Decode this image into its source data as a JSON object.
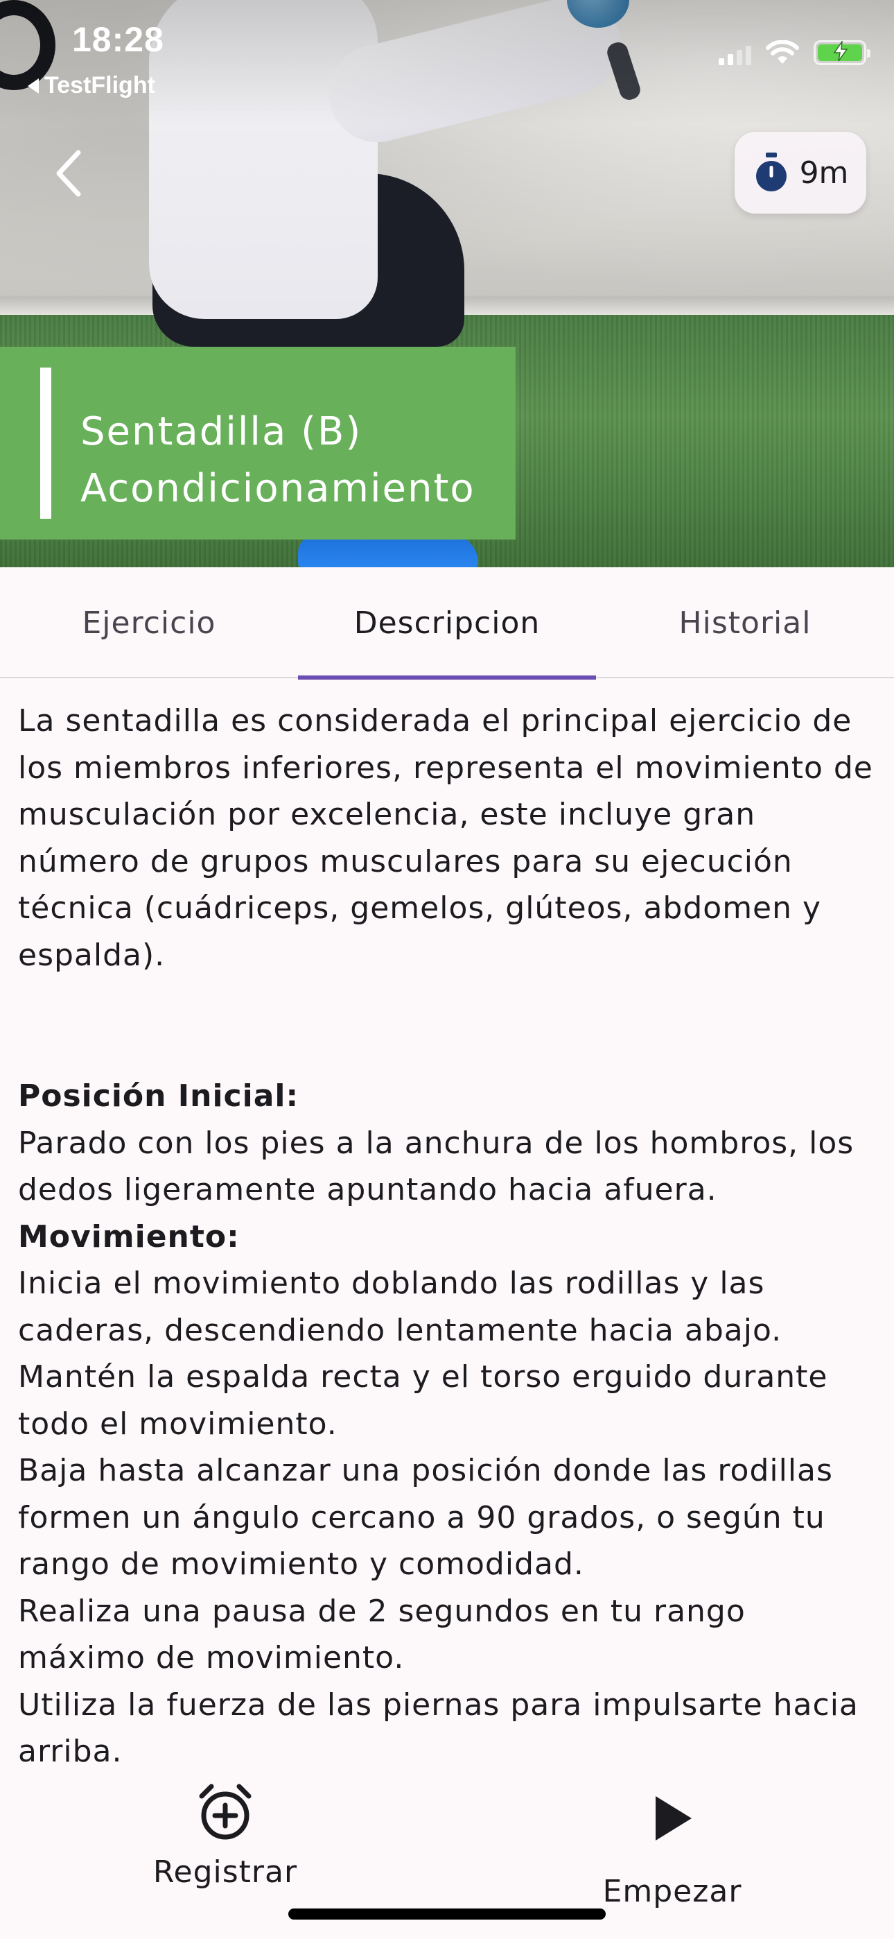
{
  "status_bar": {
    "time": "18:28",
    "back_app": "TestFlight",
    "battery_color": "#5fd34b"
  },
  "header": {
    "back_icon": "chevron-left-icon",
    "timer": {
      "icon": "stopwatch-icon",
      "label": "9m",
      "icon_color": "#1f3b73"
    }
  },
  "exercise": {
    "title": "Sentadilla (B)",
    "category": "Acondicionamiento",
    "banner_color": "#69b05b"
  },
  "tabs": [
    {
      "label": "Ejercicio",
      "active": false
    },
    {
      "label": "Descripcion",
      "active": true
    },
    {
      "label": "Historial",
      "active": false
    }
  ],
  "accent_color": "#6a4fb0",
  "description": {
    "intro": "La sentadilla es considerada el principal ejercicio de los miembros inferiores, representa el movimiento de musculación por excelencia, este incluye gran número de grupos musculares para su ejecución técnica (cuádriceps, gemelos, glúteos, abdomen y espalda).",
    "initial_heading": "Posición Inicial:",
    "initial_text": "Parado con los pies a la anchura de los hombros, los dedos ligeramente apuntando hacia afuera.",
    "movement_heading": "Movimiento:",
    "steps": [
      "Inicia el movimiento doblando las rodillas y las caderas, descendiendo lentamente hacia abajo.",
      "Mantén la espalda recta y el torso erguido durante todo el movimiento.",
      "Baja hasta alcanzar una posición donde las rodillas formen un ángulo cercano a 90 grados, o según tu rango de movimiento y comodidad.",
      "Realiza una pausa de 2 segundos en tu rango máximo de movimiento.",
      "Utiliza la fuerza de las piernas para impulsarte hacia arriba."
    ]
  },
  "actions": {
    "register": {
      "label": "Registrar",
      "icon": "alarm-add-icon"
    },
    "start": {
      "label": "Empezar",
      "icon": "play-icon"
    }
  }
}
